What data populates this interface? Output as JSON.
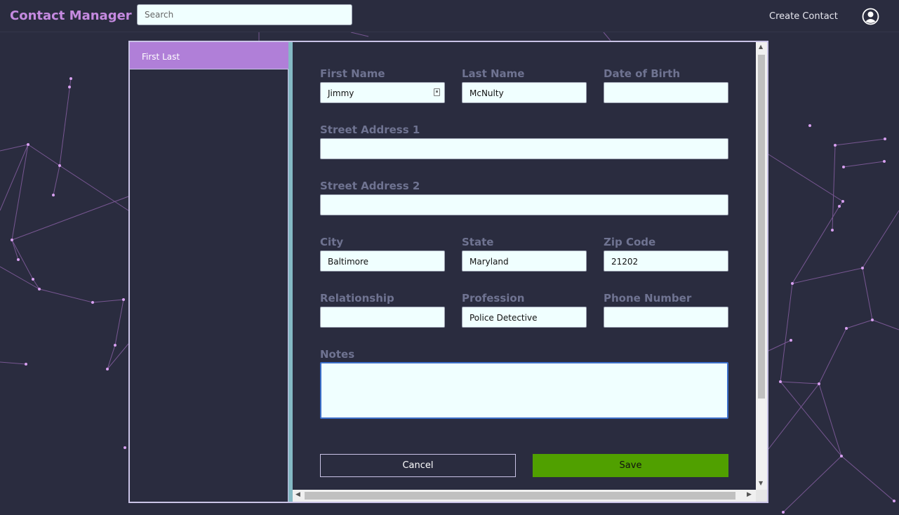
{
  "app": {
    "brand": "Contact Manager",
    "search_placeholder": "Search",
    "create_contact": "Create Contact",
    "user_icon": "user-circle-icon"
  },
  "sidebar": {
    "items": [
      {
        "label": "First Last",
        "selected": true
      }
    ]
  },
  "form": {
    "first_name": {
      "label": "First Name",
      "value": "Jimmy"
    },
    "last_name": {
      "label": "Last Name",
      "value": "McNulty"
    },
    "dob": {
      "label": "Date of Birth",
      "value": ""
    },
    "street1": {
      "label": "Street Address 1",
      "value": ""
    },
    "street2": {
      "label": "Street Address 2",
      "value": ""
    },
    "city": {
      "label": "City",
      "value": "Baltimore"
    },
    "state": {
      "label": "State",
      "value": "Maryland"
    },
    "zip": {
      "label": "Zip Code",
      "value": "21202"
    },
    "relationship": {
      "label": "Relationship",
      "value": ""
    },
    "profession": {
      "label": "Profession",
      "value": "Police Detective"
    },
    "phone": {
      "label": "Phone Number",
      "value": ""
    },
    "notes": {
      "label": "Notes",
      "value": ""
    },
    "cancel": "Cancel",
    "save": "Save"
  },
  "colors": {
    "background": "#2a2c3f",
    "brand": "#c58ae0",
    "selected_item": "#b07fd8",
    "save_button": "#50a000",
    "divider": "#84b9c4",
    "field_bg": "#f0ffff",
    "label": "#6f7391"
  }
}
